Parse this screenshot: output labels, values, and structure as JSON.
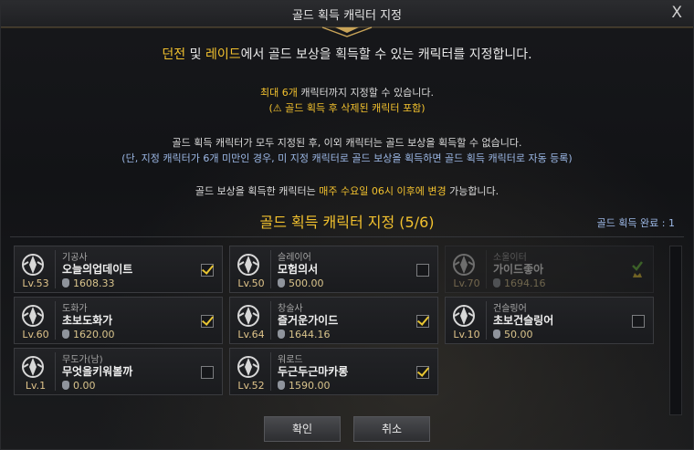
{
  "window": {
    "title": "골드 획득 캐릭터 지정",
    "close_label": "X"
  },
  "notice": {
    "line1": {
      "highlight1": "던전",
      "mid1": " 및 ",
      "highlight2": "레이드",
      "rest": "에서 골드 보상을 획득할 수 있는 캐릭터를 지정합니다."
    },
    "line2": {
      "highlight": "최대 6개",
      "rest": " 캐릭터까지 지정할 수 있습니다."
    },
    "line3": "(⚠ 골드 획득 후 삭제된 캐릭터 포함)",
    "line4": "골드 획득 캐릭터가 모두 지정된 후, 이외 캐릭터는 골드 보상을 획득할 수 없습니다.",
    "line5": "(단, 지정 캐릭터가 6개 미만인 경우, 미 지정 캐릭터로 골드 보상을 획득하면 골드 획득 캐릭터로 자동 등록)",
    "line6": {
      "pre": "골드 보상을 획득한 캐릭터는 ",
      "highlight": "매주 수요일 06시 이후에 변경",
      "post": " 가능합니다."
    }
  },
  "section": {
    "title": "골드 획득 캐릭터 지정 (5/6)",
    "done_label": "골드 획득 완료 : 1"
  },
  "characters": [
    {
      "class": "기공사",
      "name": "오늘의업데이트",
      "level": "Lv.53",
      "gold": "1608.33",
      "checked": true,
      "icon": "soulfist-emblem-icon"
    },
    {
      "class": "슬레이어",
      "name": "모험의서",
      "level": "Lv.50",
      "gold": "500.00",
      "checked": false,
      "icon": "slayer-emblem-icon"
    },
    {
      "class": "소울이터",
      "name": "가이드좋아",
      "level": "Lv.70",
      "gold": "1694.16",
      "done": true,
      "icon": "souleater-emblem-icon"
    },
    {
      "class": "도화가",
      "name": "초보도화가",
      "level": "Lv.60",
      "gold": "1620.00",
      "checked": true,
      "icon": "artist-emblem-icon"
    },
    {
      "class": "창술사",
      "name": "즐거운가이드",
      "level": "Lv.64",
      "gold": "1644.16",
      "checked": true,
      "icon": "lancemaster-emblem-icon"
    },
    {
      "class": "건슬링어",
      "name": "초보건슬링어",
      "level": "Lv.10",
      "gold": "50.00",
      "checked": false,
      "icon": "gunslinger-emblem-icon"
    },
    {
      "class": "무도가(남)",
      "name": "무엇을키워볼까",
      "level": "Lv.1",
      "gold": "0.00",
      "checked": false,
      "icon": "fighter-emblem-icon"
    },
    {
      "class": "워로드",
      "name": "두근두근마카롱",
      "level": "Lv.52",
      "gold": "1590.00",
      "checked": true,
      "icon": "warlord-emblem-icon"
    }
  ],
  "buttons": {
    "confirm": "확인",
    "cancel": "취소"
  },
  "colors": {
    "accent_gold": "#f2c12e",
    "info_blue": "#9cb8e6",
    "done_green": "#6bc23a"
  }
}
